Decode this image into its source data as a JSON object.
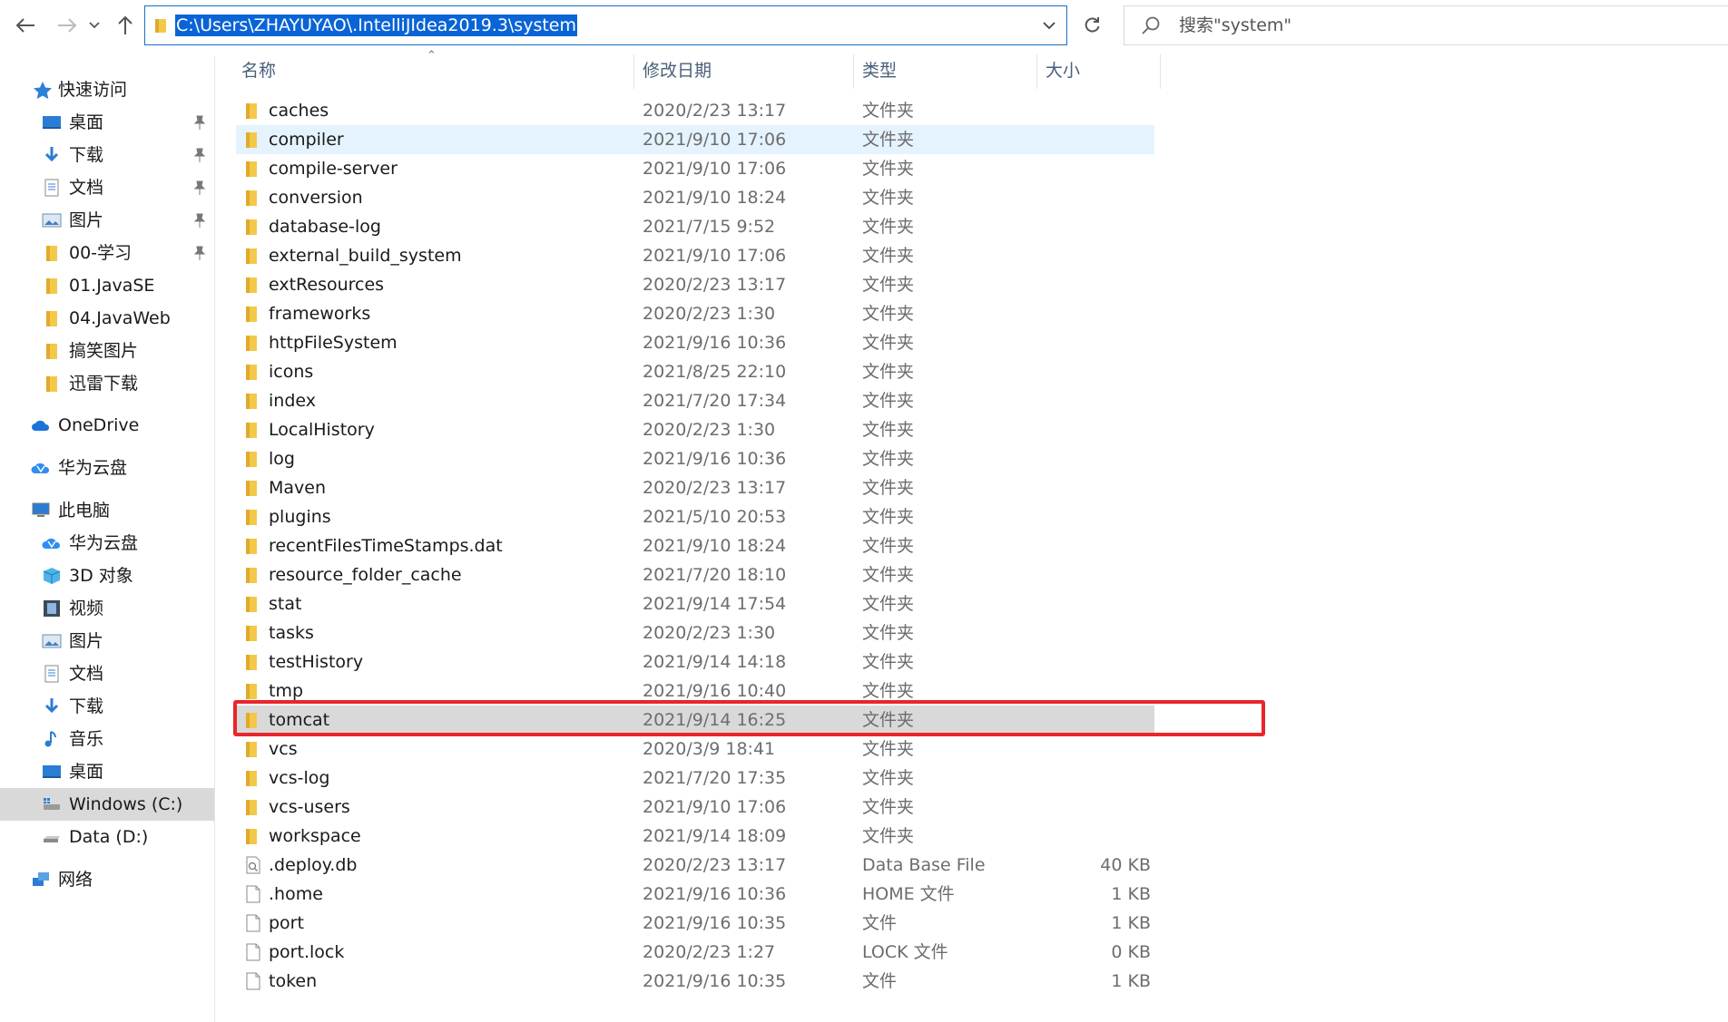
{
  "address": {
    "path": "C:\\Users\\ZHAYUYAO\\.IntelliJIdea2019.3\\system"
  },
  "search": {
    "placeholder": "搜索\"system\""
  },
  "columns": {
    "name": "名称",
    "date": "修改日期",
    "type": "类型",
    "size": "大小"
  },
  "sidebar": {
    "items": [
      {
        "label": "快速访问",
        "icon": "star-icon"
      },
      {
        "label": "桌面",
        "icon": "desktop-icon",
        "pinned": true
      },
      {
        "label": "下载",
        "icon": "download-icon",
        "pinned": true
      },
      {
        "label": "文档",
        "icon": "document-icon",
        "pinned": true
      },
      {
        "label": "图片",
        "icon": "picture-icon",
        "pinned": true
      },
      {
        "label": "00-学习",
        "icon": "folder-icon",
        "pinned": true
      },
      {
        "label": "01.JavaSE",
        "icon": "folder-icon"
      },
      {
        "label": "04.JavaWeb",
        "icon": "folder-icon"
      },
      {
        "label": "搞笑图片",
        "icon": "folder-icon"
      },
      {
        "label": "迅雷下载",
        "icon": "folder-icon"
      },
      {
        "label": "OneDrive",
        "icon": "cloud-icon"
      },
      {
        "label": "华为云盘",
        "icon": "huawei-cloud-icon"
      },
      {
        "label": "此电脑",
        "icon": "computer-icon"
      },
      {
        "label": "华为云盘",
        "icon": "huawei-cloud-icon"
      },
      {
        "label": "3D 对象",
        "icon": "cube-icon"
      },
      {
        "label": "视频",
        "icon": "video-icon"
      },
      {
        "label": "图片",
        "icon": "picture-icon"
      },
      {
        "label": "文档",
        "icon": "document-icon"
      },
      {
        "label": "下载",
        "icon": "download-icon"
      },
      {
        "label": "音乐",
        "icon": "music-icon"
      },
      {
        "label": "桌面",
        "icon": "desktop-icon"
      },
      {
        "label": "Windows (C:)",
        "icon": "drive-c-icon",
        "selected": true
      },
      {
        "label": "Data (D:)",
        "icon": "drive-icon"
      },
      {
        "label": "网络",
        "icon": "network-icon"
      }
    ]
  },
  "files": [
    {
      "name": "caches",
      "date": "2020/2/23 13:17",
      "type": "文件夹",
      "size": "",
      "kind": "folder"
    },
    {
      "name": "compiler",
      "date": "2021/9/10 17:06",
      "type": "文件夹",
      "size": "",
      "kind": "folder",
      "hover": true
    },
    {
      "name": "compile-server",
      "date": "2021/9/10 17:06",
      "type": "文件夹",
      "size": "",
      "kind": "folder"
    },
    {
      "name": "conversion",
      "date": "2021/9/10 18:24",
      "type": "文件夹",
      "size": "",
      "kind": "folder"
    },
    {
      "name": "database-log",
      "date": "2021/7/15 9:52",
      "type": "文件夹",
      "size": "",
      "kind": "folder"
    },
    {
      "name": "external_build_system",
      "date": "2021/9/10 17:06",
      "type": "文件夹",
      "size": "",
      "kind": "folder"
    },
    {
      "name": "extResources",
      "date": "2020/2/23 13:17",
      "type": "文件夹",
      "size": "",
      "kind": "folder"
    },
    {
      "name": "frameworks",
      "date": "2020/2/23 1:30",
      "type": "文件夹",
      "size": "",
      "kind": "folder"
    },
    {
      "name": "httpFileSystem",
      "date": "2021/9/16 10:36",
      "type": "文件夹",
      "size": "",
      "kind": "folder"
    },
    {
      "name": "icons",
      "date": "2021/8/25 22:10",
      "type": "文件夹",
      "size": "",
      "kind": "folder"
    },
    {
      "name": "index",
      "date": "2021/7/20 17:34",
      "type": "文件夹",
      "size": "",
      "kind": "folder"
    },
    {
      "name": "LocalHistory",
      "date": "2020/2/23 1:30",
      "type": "文件夹",
      "size": "",
      "kind": "folder"
    },
    {
      "name": "log",
      "date": "2021/9/16 10:36",
      "type": "文件夹",
      "size": "",
      "kind": "folder"
    },
    {
      "name": "Maven",
      "date": "2020/2/23 13:17",
      "type": "文件夹",
      "size": "",
      "kind": "folder"
    },
    {
      "name": "plugins",
      "date": "2021/5/10 20:53",
      "type": "文件夹",
      "size": "",
      "kind": "folder"
    },
    {
      "name": "recentFilesTimeStamps.dat",
      "date": "2021/9/10 18:24",
      "type": "文件夹",
      "size": "",
      "kind": "folder"
    },
    {
      "name": "resource_folder_cache",
      "date": "2021/7/20 18:10",
      "type": "文件夹",
      "size": "",
      "kind": "folder"
    },
    {
      "name": "stat",
      "date": "2021/9/14 17:54",
      "type": "文件夹",
      "size": "",
      "kind": "folder"
    },
    {
      "name": "tasks",
      "date": "2020/2/23 1:30",
      "type": "文件夹",
      "size": "",
      "kind": "folder"
    },
    {
      "name": "testHistory",
      "date": "2021/9/14 14:18",
      "type": "文件夹",
      "size": "",
      "kind": "folder"
    },
    {
      "name": "tmp",
      "date": "2021/9/16 10:40",
      "type": "文件夹",
      "size": "",
      "kind": "folder"
    },
    {
      "name": "tomcat",
      "date": "2021/9/14 16:25",
      "type": "文件夹",
      "size": "",
      "kind": "folder",
      "selected": true,
      "highlighted": true
    },
    {
      "name": "vcs",
      "date": "2020/3/9 18:41",
      "type": "文件夹",
      "size": "",
      "kind": "folder"
    },
    {
      "name": "vcs-log",
      "date": "2021/7/20 17:35",
      "type": "文件夹",
      "size": "",
      "kind": "folder"
    },
    {
      "name": "vcs-users",
      "date": "2021/9/10 17:06",
      "type": "文件夹",
      "size": "",
      "kind": "folder"
    },
    {
      "name": "workspace",
      "date": "2021/9/14 18:09",
      "type": "文件夹",
      "size": "",
      "kind": "folder"
    },
    {
      "name": ".deploy.db",
      "date": "2020/2/23 13:17",
      "type": "Data Base File",
      "size": "40 KB",
      "kind": "db"
    },
    {
      "name": ".home",
      "date": "2021/9/16 10:36",
      "type": "HOME 文件",
      "size": "1 KB",
      "kind": "file"
    },
    {
      "name": "port",
      "date": "2021/9/16 10:35",
      "type": "文件",
      "size": "1 KB",
      "kind": "file"
    },
    {
      "name": "port.lock",
      "date": "2020/2/23 1:27",
      "type": "LOCK 文件",
      "size": "0 KB",
      "kind": "file"
    },
    {
      "name": "token",
      "date": "2021/9/16 10:35",
      "type": "文件",
      "size": "1 KB",
      "kind": "file"
    }
  ],
  "colors": {
    "accent": "#0a64d6",
    "selection": "#d9d9d9",
    "hover": "#e5f3ff",
    "highlight_box": "#e8262b",
    "folder": "#f4c94a"
  }
}
